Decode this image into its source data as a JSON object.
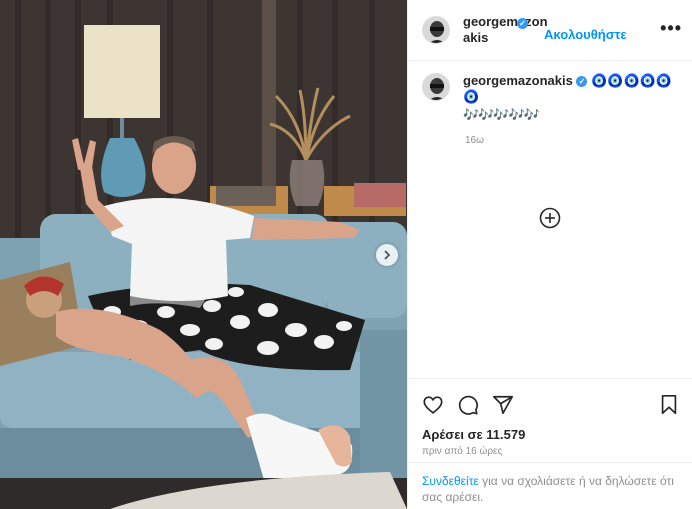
{
  "post": {
    "username_line1": "georgemazon",
    "username_line2": "akis",
    "username": "georgemazonakis",
    "follow_label": "Ακολουθήστε",
    "more_label": "•••",
    "verified_mark": "✓"
  },
  "caption": {
    "eyes": "🧿🧿🧿🧿🧿🧿",
    "notes": "🎶🎶🎶🎶🎶",
    "age": "16ω"
  },
  "engagement": {
    "likes": "Αρέσει σε 11.579",
    "posted": "πριν από 16 ώρες"
  },
  "login": {
    "link": "Συνδεθείτε",
    "rest": " για να σχολιάσετε ή να δηλώσετε ότι σας αρέσει."
  },
  "icons": {
    "like": "heart-icon",
    "comment": "comment-icon",
    "share": "share-icon",
    "save": "bookmark-icon",
    "load_more": "plus-circle-icon",
    "next": "chevron-right-icon"
  },
  "colors": {
    "link": "#0095f6",
    "verified": "#3897f0",
    "sofa": "#7fa2b3",
    "curtain": "#3c3532"
  }
}
